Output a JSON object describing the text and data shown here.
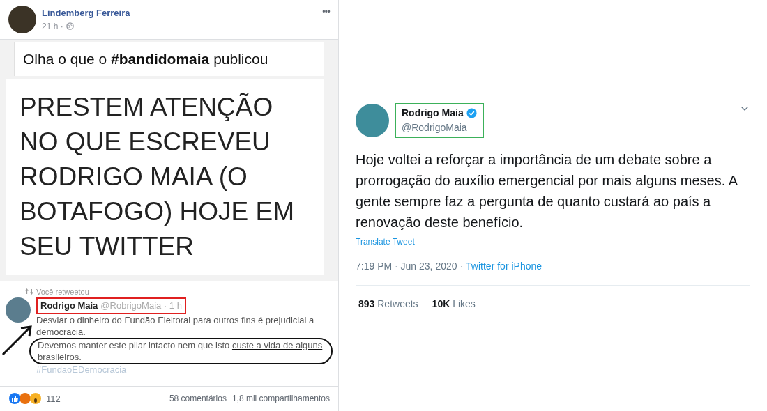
{
  "facebook_post": {
    "author": "Lindemberg Ferreira",
    "time": "21 h ·",
    "more": "•••",
    "image": {
      "caption": "Olha o que o **#bandidomaia** publicou",
      "headline": "PRESTEM ATENÇÃO NO QUE ESCREVEU RODRIGO MAIA (O BOTAFOGO) HOJE EM SEU TWITTER",
      "retweet": {
        "context": "Você retweetou",
        "name": "Rodrigo Maia",
        "handle": "@RobrigoMaia · 1 h",
        "text_1": "Desviar o dinheiro do Fundão Eleitoral para outros fins é prejudicial a democracia.",
        "text_2_before": "Devemos manter este pilar intacto nem que isto ",
        "text_2_underlined": "custe a vida de alguns",
        "text_2_after": " brasileiros.",
        "hashtag": "#FundaoEDemocracia"
      }
    },
    "reactions_count": "112",
    "comments": "58 comentários",
    "shares": "1,8 mil compartilhamentos"
  },
  "tweet": {
    "name": "Rodrigo Maia",
    "handle": "@RodrigoMaia",
    "text": "Hoje voltei a reforçar a importância de um debate sobre a prorrogação do auxílio emergencial por mais alguns meses. A gente sempre faz a pergunta de quanto custará ao país a renovação deste benefício.",
    "translate": "Translate Tweet",
    "timestamp": "7:19 PM · Jun 23, 2020 ·",
    "source": "Twitter for iPhone",
    "stats": [
      {
        "count": "893",
        "label": "Retweets"
      },
      {
        "count": "10K",
        "label": "Likes"
      }
    ]
  }
}
